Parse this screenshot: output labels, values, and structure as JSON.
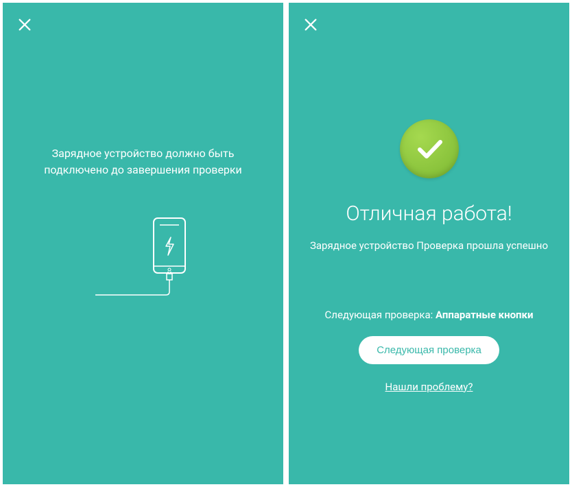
{
  "screen1": {
    "instruction": "Зарядное устройство должно быть подключено до завершения проверки"
  },
  "screen2": {
    "successTitle": "Отличная работа!",
    "successSubtitle": "Зарядное устройство Проверка прошла успешно",
    "nextCheckPrefix": "Следующая проверка: ",
    "nextCheckName": "Аппаратные кнопки",
    "nextButton": "Следующая проверка",
    "problemLink": "Нашли проблему?"
  }
}
